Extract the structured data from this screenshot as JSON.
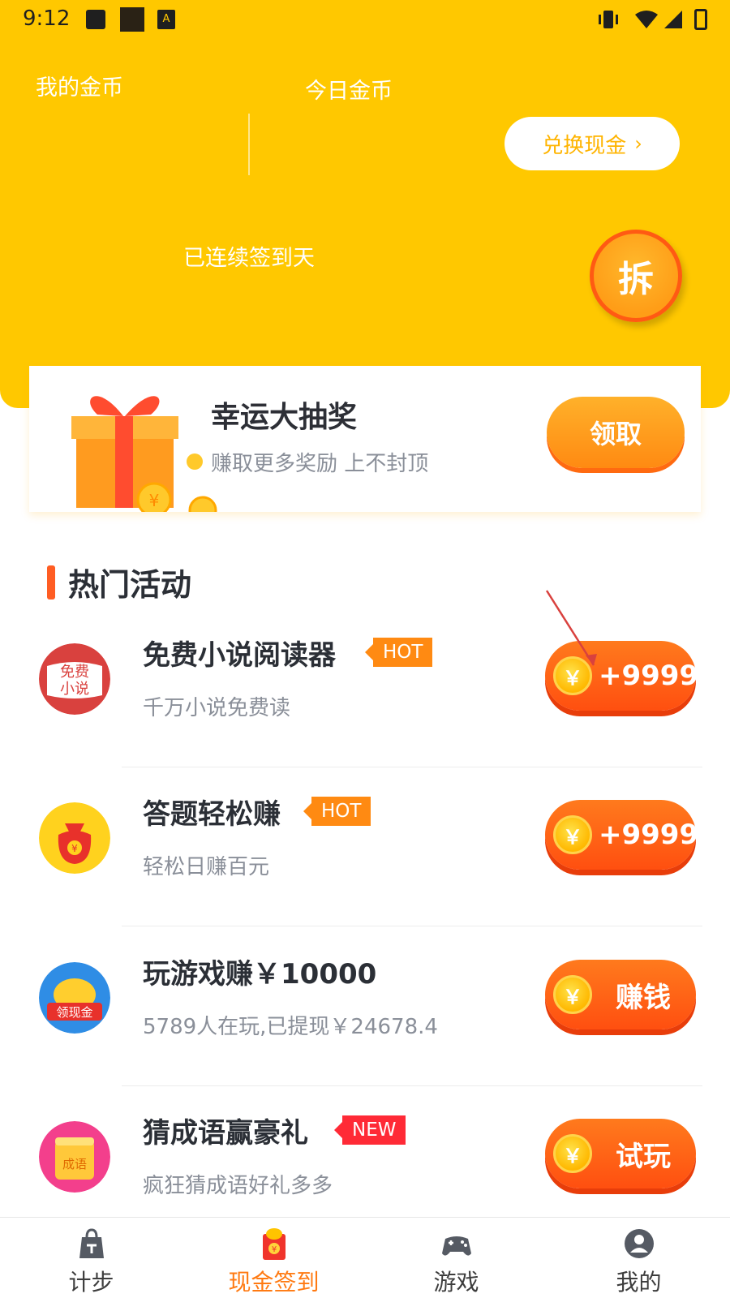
{
  "status_bar": {
    "time": "9:12"
  },
  "header": {
    "my_coins_label": "我的金币",
    "today_coins_label": "今日金币",
    "exchange_button": "兑换现金",
    "signed_days_text": "已连续签到天",
    "open_button": "拆"
  },
  "lottery": {
    "title": "幸运大抽奖",
    "subtitle": "赚取更多奖励 上不封顶",
    "button": "领取"
  },
  "section": {
    "title": "热门活动"
  },
  "activities": [
    {
      "title": "免费小说阅读器",
      "badge": "HOT",
      "subtitle": "千万小说免费读",
      "button": "+9999",
      "icon_text": "免费\n小说"
    },
    {
      "title": "答题轻松赚",
      "badge": "HOT",
      "subtitle": "轻松日赚百元",
      "button": "+9999",
      "icon_text": ""
    },
    {
      "title": "玩游戏赚￥10000",
      "badge": "",
      "subtitle": "5789人在玩,已提现￥24678.4",
      "button": "赚钱",
      "icon_text": "领现金"
    },
    {
      "title": "猜成语赢豪礼",
      "badge": "NEW",
      "subtitle": "疯狂猜成语好礼多多",
      "button": "试玩",
      "icon_text": "成语"
    }
  ],
  "coin_symbol": "￥",
  "bottom_nav": [
    {
      "label": "计步",
      "icon": "steps-bag-icon",
      "active": false
    },
    {
      "label": "现金签到",
      "icon": "red-envelope-icon",
      "active": true
    },
    {
      "label": "游戏",
      "icon": "gamepad-icon",
      "active": false
    },
    {
      "label": "我的",
      "icon": "user-icon",
      "active": false
    }
  ],
  "colors": {
    "header_bg": "#ffc800",
    "accent_orange": "#ff7a12",
    "button_red": "#ff4f10",
    "badge_hot": "#ff8a12",
    "badge_new": "#ff2a36"
  }
}
